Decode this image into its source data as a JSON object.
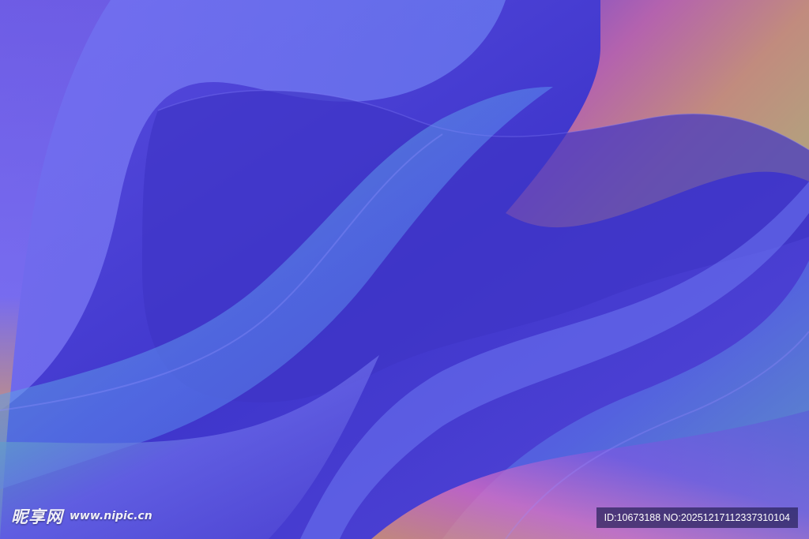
{
  "image": {
    "description_colors": {
      "base": "#4a3fd0",
      "violet": "#6a5cf0",
      "deep": "#3e2fc8",
      "teal": "#5fd0b0",
      "orange": "#e8a060",
      "pink": "#e070c0"
    }
  },
  "watermark": {
    "brand": "昵享网",
    "url": "www.nipic.cn"
  },
  "id_bar": {
    "text": "ID:10673188 NO:20251217112337310104"
  }
}
